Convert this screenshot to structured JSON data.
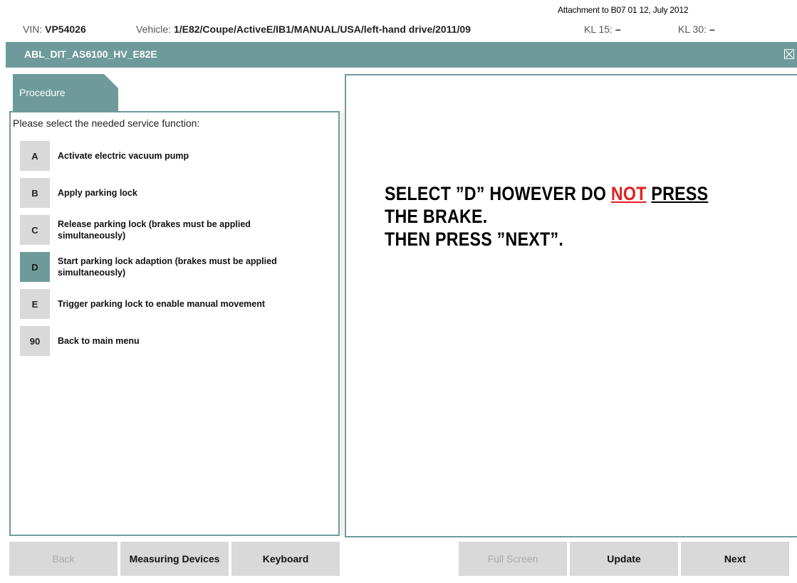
{
  "attachment": "Attachment to B07 01 12, July 2012",
  "header": {
    "vin_label": "VIN:",
    "vin_value": "VP54026",
    "vehicle_label": "Vehicle:",
    "vehicle_value": "1/E82/Coupe/ActiveE/IB1/MANUAL/USA/left-hand drive/2011/09",
    "kl15_label": "KL 15:",
    "kl15_value": "–",
    "kl30_label": "KL 30:",
    "kl30_value": "–"
  },
  "window": {
    "title": "ABL_DIT_AS6100_HV_E82E",
    "close_icon": "close-icon"
  },
  "tab": {
    "label": "Procedure"
  },
  "procedure": {
    "prompt": "Please select the needed service function:",
    "options": [
      {
        "key": "A",
        "line1": "Activate electric vacuum pump",
        "line2": ""
      },
      {
        "key": "B",
        "line1": "Apply parking lock",
        "line2": ""
      },
      {
        "key": "C",
        "line1": "Release parking lock (brakes must be applied",
        "line2": "simultaneously)"
      },
      {
        "key": "D",
        "line1": "Start parking lock adaption (brakes must be applied",
        "line2": "simultaneously)"
      },
      {
        "key": "E",
        "line1": "Trigger parking lock to enable manual movement",
        "line2": ""
      },
      {
        "key": "90",
        "line1": "Back to main menu",
        "line2": ""
      }
    ],
    "selected_key": "D"
  },
  "instruction": {
    "part1": "SELECT ”D” HOWEVER DO ",
    "not": "NOT",
    "space": " ",
    "press": "PRESS",
    "line2": "THE BRAKE.",
    "line3": "THEN PRESS ”NEXT”."
  },
  "buttons": {
    "back": "Back",
    "measuring_devices": "Measuring Devices",
    "keyboard": "Keyboard",
    "full_screen": "Full Screen",
    "update": "Update",
    "next": "Next"
  },
  "colors": {
    "accent": "#6e9a9a",
    "button_bg": "#d9d9d9",
    "warning": "#e32020"
  }
}
